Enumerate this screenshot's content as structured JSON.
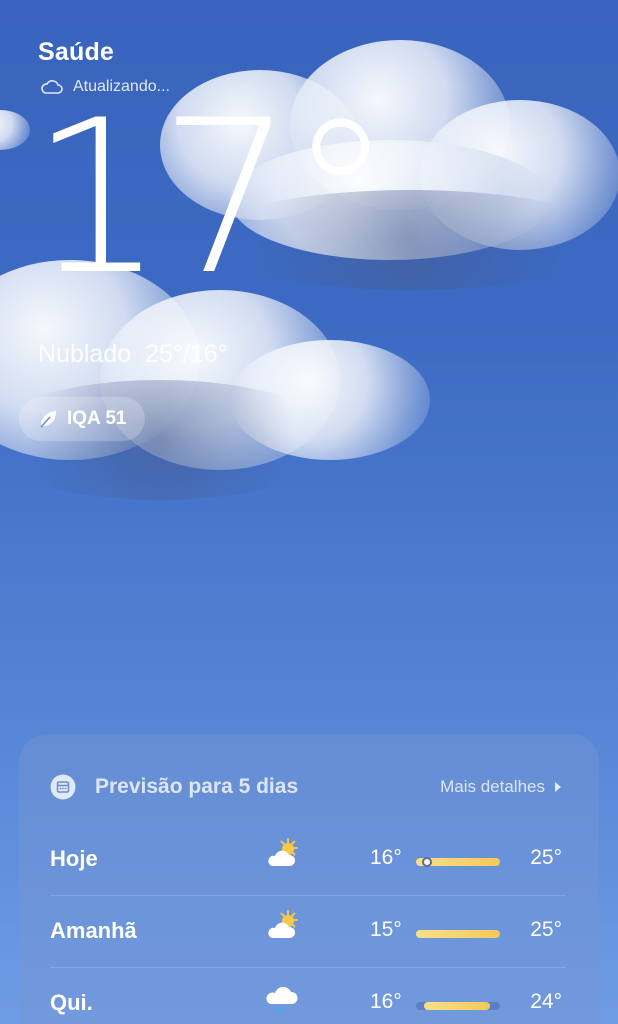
{
  "location": {
    "city": "Saúde",
    "status_text": "Atualizando..."
  },
  "current": {
    "temperature": "17°",
    "condition": "Nublado",
    "range": "25°/16°",
    "aqi_label": "IQA 51"
  },
  "forecast": {
    "title": "Previsão para 5 dias",
    "more_label": "Mais detalhes",
    "days": [
      {
        "label": "Hoje",
        "icon": "partly-cloudy-icon",
        "low": "16°",
        "high": "25°",
        "bar_start": 0.0,
        "bar_end": 1.0,
        "current_marker": 0.1
      },
      {
        "label": "Amanhã",
        "icon": "partly-cloudy-icon",
        "low": "15°",
        "high": "25°",
        "bar_start": 0.0,
        "bar_end": 1.0
      },
      {
        "label": "Qui.",
        "icon": "rain-cloud-icon",
        "low": "16°",
        "high": "24°",
        "bar_start": 0.1,
        "bar_end": 0.88
      }
    ]
  },
  "colors": {
    "bar_fill": "#f4c95a",
    "sky_top": "#3a64bd",
    "sky_bottom": "#6f9ce4"
  }
}
